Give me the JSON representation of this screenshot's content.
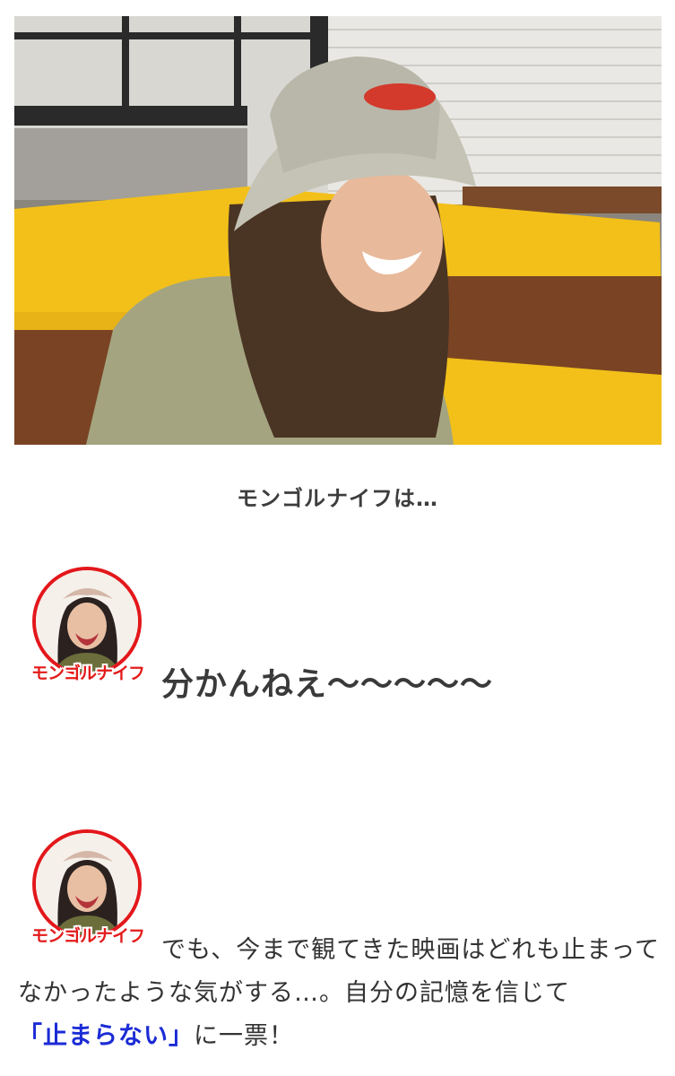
{
  "photo": {
    "alt": ""
  },
  "caption": "モンゴルナイフは…",
  "speaker1": {
    "name": "モンゴルナイフ",
    "speech": "分かんねえ〜〜〜〜〜"
  },
  "speaker2": {
    "name": "モンゴルナイフ",
    "speech_part1": "でも、今まで観てきた映画はどれも止まってなかったような気がする…。自分の記憶を信じて",
    "speech_highlight": "「止まらない」",
    "speech_part2": "に一票！"
  },
  "colors": {
    "avatar_ring": "#e3171b",
    "highlight": "#1b2bd6",
    "sofa": "#f2c019"
  }
}
